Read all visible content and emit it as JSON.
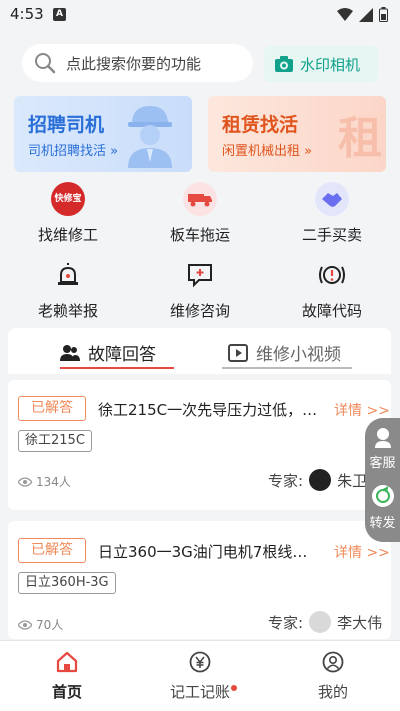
{
  "status_bar": {
    "time": "4:53",
    "notif_letter": "A"
  },
  "search": {
    "placeholder": "点此搜索你要的功能"
  },
  "watermark": {
    "label": "水印相机"
  },
  "banners": {
    "left": {
      "title": "招聘司机",
      "subtitle": "司机招聘找活 »"
    },
    "right": {
      "title": "租赁找活",
      "subtitle": "闲置机械出租 »",
      "deco": "租"
    }
  },
  "features": [
    {
      "label": "找维修工",
      "icon": "kuaixiubao-icon",
      "icon_text": "快修宝"
    },
    {
      "label": "板车拖运",
      "icon": "truck-icon"
    },
    {
      "label": "二手买卖",
      "icon": "handshake-icon"
    },
    {
      "label": "老赖举报",
      "icon": "alarm-icon"
    },
    {
      "label": "维修咨询",
      "icon": "consult-icon"
    },
    {
      "label": "故障代码",
      "icon": "warning-code-icon"
    }
  ],
  "tabs": [
    {
      "label": "故障回答"
    },
    {
      "label": "维修小视频"
    }
  ],
  "questions": [
    {
      "status": "已解答",
      "title": "徐工215C一次先导压力过低，…",
      "detail": "详情 >>",
      "tag": "徐工215C",
      "views": "134人",
      "expert_label": "专家:",
      "expert_name": "朱卫东"
    },
    {
      "status": "已解答",
      "title": "日立360一3G油门电机7根线…",
      "detail": "详情 >>",
      "tag": "日立360H-3G",
      "views": "70人",
      "expert_label": "专家:",
      "expert_name": "李大伟"
    }
  ],
  "floating": {
    "service": "客服",
    "share": "转发"
  },
  "nav": [
    {
      "label": "首页"
    },
    {
      "label": "记工记账"
    },
    {
      "label": "我的"
    }
  ],
  "colors": {
    "accent": "#e5493f",
    "orange": "#f08a5a",
    "teal": "#12a18a",
    "blue": "#2a6fd8"
  }
}
